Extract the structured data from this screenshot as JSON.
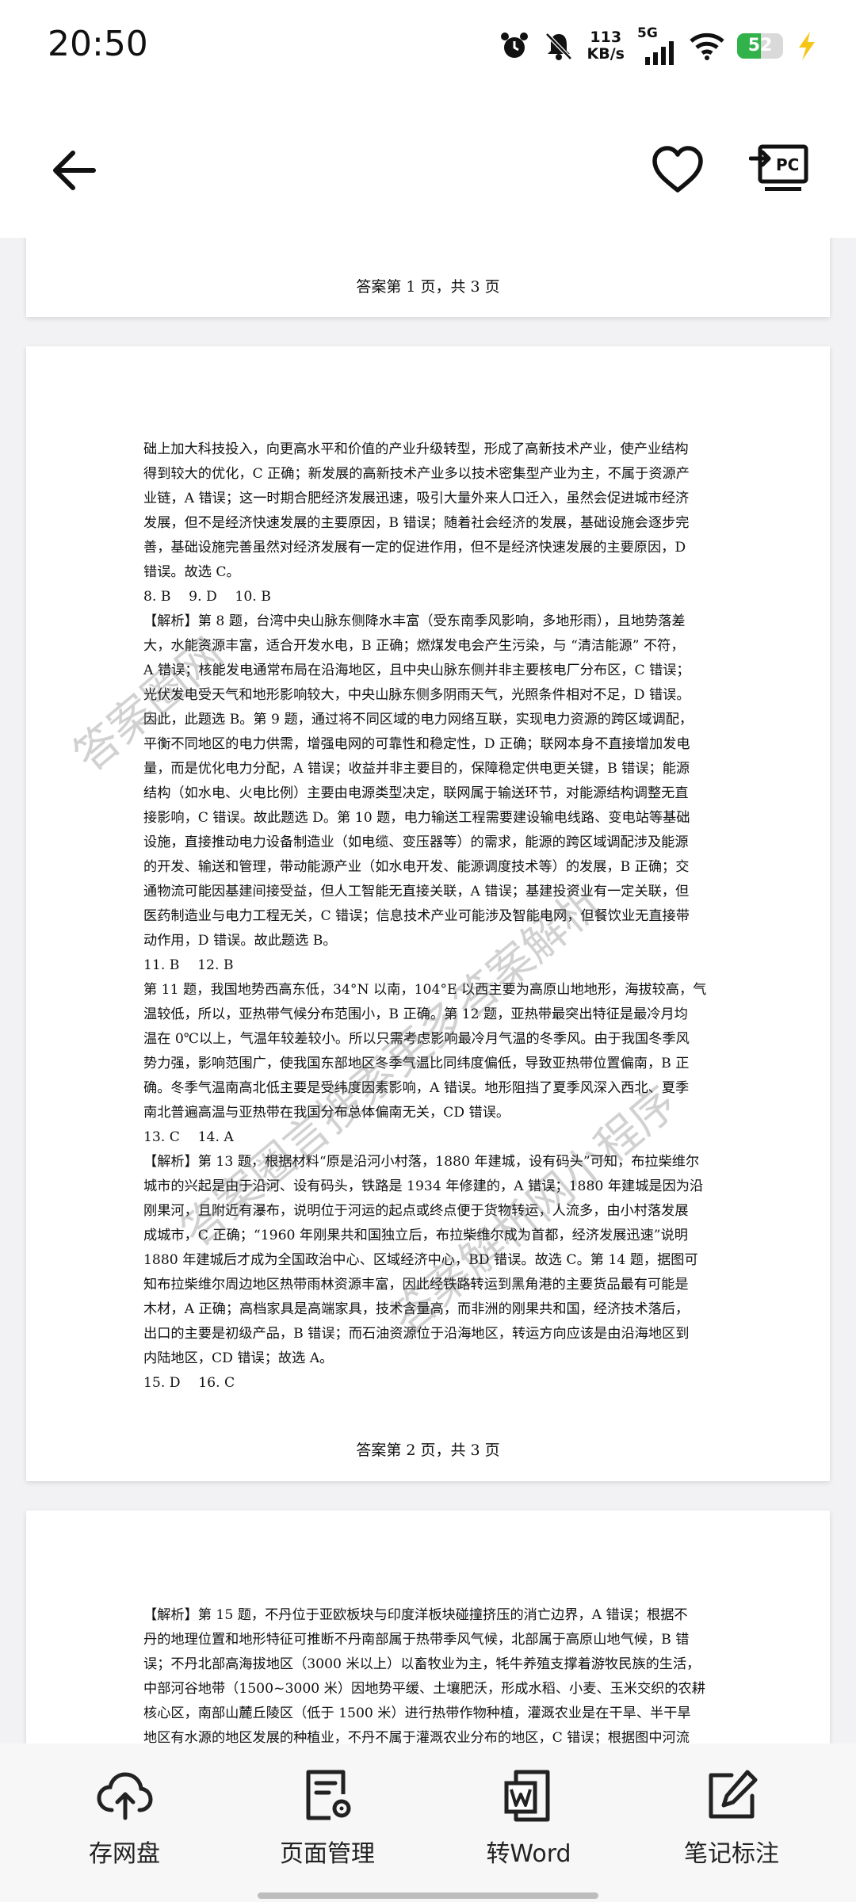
{
  "status": {
    "time": "20:50",
    "net_speed_value": "113",
    "net_speed_unit": "KB/s",
    "signal_label": "5G",
    "battery": "52",
    "battery_level": 0.52
  },
  "toolbar": {
    "back_icon": "arrow-left-icon",
    "favorite_icon": "heart-icon",
    "pc_icon": "pc-cast-icon",
    "pc_text": "PC"
  },
  "pages": {
    "p1_footer": "答案第 1 页，共 3 页",
    "p2_footer": "答案第 2 页，共 3 页",
    "p2_lines": [
      "础上加大科技投入，向更高水平和价值的产业升级转型，形成了高新技术产业，使产业结构",
      "得到较大的优化，C 正确；新发展的高新技术产业多以技术密集型产业为主，不属于资源产",
      "业链，A 错误；这一时期合肥经济发展迅速，吸引大量外来人口迁入，虽然会促进城市经济",
      "发展，但不是经济快速发展的主要原因，B 错误；随着社会经济的发展，基础设施会逐步完",
      "善，基础设施完善虽然对经济发展有一定的促进作用，但不是经济快速发展的主要原因，D",
      "错误。故选 C。",
      "8. B　 9. D　 10. B",
      "【解析】第 8 题，台湾中央山脉东侧降水丰富（受东南季风影响，多地形雨），且地势落差",
      "大，水能资源丰富，适合开发水电，B 正确；燃煤发电会产生污染，与 “清洁能源” 不符，",
      "A 错误；核能发电通常布局在沿海地区，且中央山脉东侧并非主要核电厂分布区，C 错误；",
      "光伏发电受天气和地形影响较大，中央山脉东侧多阴雨天气，光照条件相对不足，D 错误。",
      "因此，此题选 B。第 9 题，通过将不同区域的电力网络互联，实现电力资源的跨区域调配，",
      "平衡不同地区的电力供需，增强电网的可靠性和稳定性，D 正确；联网本身不直接增加发电",
      "量，而是优化电力分配，A 错误；收益并非主要目的，保障稳定供电更关键，B 错误；能源",
      "结构（如水电、火电比例）主要由电源类型决定，联网属于输送环节，对能源结构调整无直",
      "接影响，C 错误。故此题选 D。第 10 题，电力输送工程需要建设输电线路、变电站等基础",
      "设施，直接推动电力设备制造业（如电缆、变压器等）的需求，能源的跨区域调配涉及能源",
      "的开发、输送和管理，带动能源产业（如水电开发、能源调度技术等）的发展，B 正确；交",
      "通物流可能因基建间接受益，但人工智能无直接关联，A 错误；基建投资业有一定关联，但",
      "医药制造业与电力工程无关，C 错误；信息技术产业可能涉及智能电网，但餐饮业无直接带",
      "动作用，D 错误。故此题选 B。",
      "11. B　 12. B",
      "第 11 题，我国地势西高东低，34°N 以南，104°E 以西主要为高原山地地形，海拔较高，气",
      "温较低，所以，亚热带气候分布范围小，B 正确。第 12 题，亚热带最突出特征是最冷月均",
      "温在 0℃以上，气温年较差较小。所以只需考虑影响最冷月气温的冬季风。由于我国冬季风",
      "势力强，影响范围广，使我国东部地区冬季气温比同纬度偏低，导致亚热带位置偏南，B 正",
      "确。冬季气温南高北低主要是受纬度因素影响，A 错误。地形阻挡了夏季风深入西北、夏季",
      "南北普遍高温与亚热带在我国分布总体偏南无关，CD 错误。",
      "13. C　 14. A",
      "【解析】第 13 题，根据材料“原是沿河小村落，1880 年建城，设有码头”可知，布拉柴维尔",
      "城市的兴起是由于沿河、设有码头，铁路是 1934 年修建的，A 错误；1880 年建城是因为沿",
      "刚果河，且附近有瀑布，说明位于河运的起点或终点便于货物转运，人流多，由小村落发展",
      "成城市，C 正确；“1960 年刚果共和国独立后，布拉柴维尔成为首都，经济发展迅速”说明",
      "1880 年建城后才成为全国政治中心、区域经济中心，BD 错误。故选 C。第 14 题，据图可",
      "知布拉柴维尔周边地区热带雨林资源丰富，因此经铁路转运到黑角港的主要货品最有可能是",
      "木材，A 正确；高档家具是高端家具，技术含量高，而非洲的刚果共和国，经济技术落后，",
      "出口的主要是初级产品，B 错误；而石油资源位于沿海地区，转运方向应该是由沿海地区到",
      "内陆地区，CD 错误；故选 A。",
      "15. D　 16. C"
    ],
    "p3_lines": [
      "【解析】第 15 题，不丹位于亚欧板块与印度洋板块碰撞挤压的消亡边界，A 错误；根据不",
      "丹的地理位置和地形特征可推断不丹南部属于热带季风气候，北部属于高原山地气候，B 错",
      "误；不丹北部高海拔地区（3000 米以上）以畜牧业为主，牦牛养殖支撑着游牧民族的生活，",
      "中部河谷地带（1500~3000 米）因地势平缓、土壤肥沃，形成水稻、小麦、玉米交织的农耕",
      "核心区，南部山麓丘陵区（低于 1500 米）进行热带作物种植，灌溉农业是在干旱、半干旱",
      "地区有水源的地区发展的种植业，不丹不属于灌溉农业分布的地区，C 错误；根据图中河流"
    ],
    "watermarks": [
      "答案圈网",
      "答案圈言搜索更多答案解析",
      "答案解析网小程序"
    ]
  },
  "bottom_tools": [
    {
      "label": "存网盘",
      "icon": "cloud-upload-icon"
    },
    {
      "label": "页面管理",
      "icon": "page-settings-icon"
    },
    {
      "label": "转Word",
      "icon": "word-convert-icon"
    },
    {
      "label": "笔记标注",
      "icon": "edit-note-icon"
    }
  ]
}
